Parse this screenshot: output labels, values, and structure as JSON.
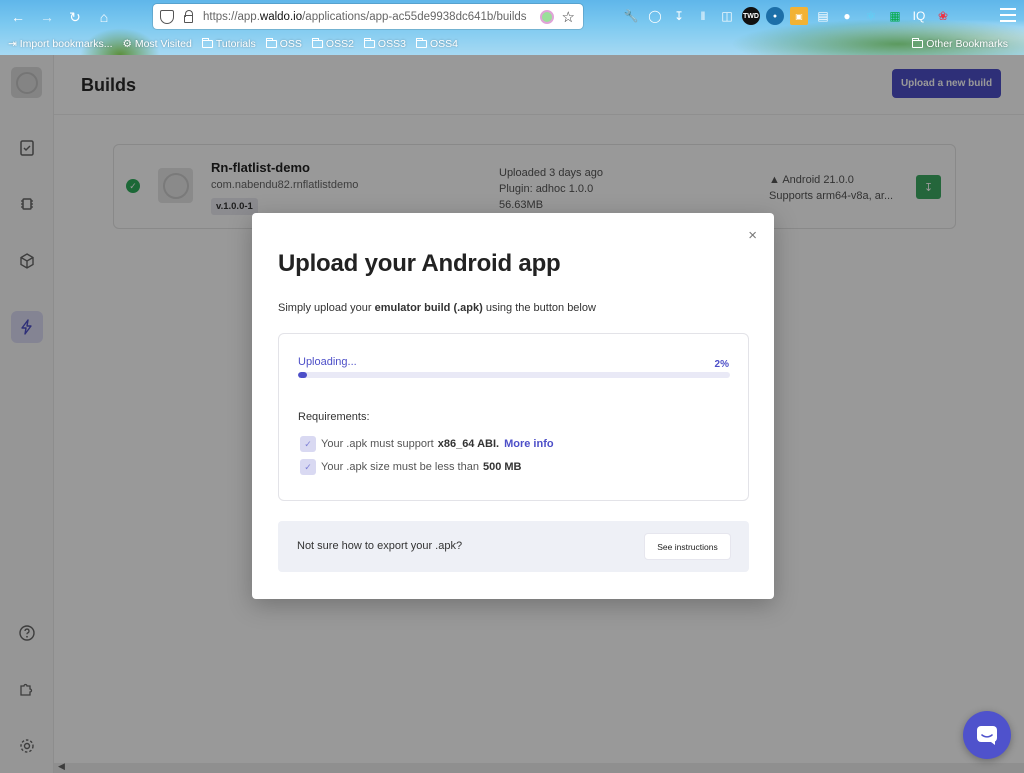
{
  "browser": {
    "url_prefix": "https://app.",
    "url_domain": "waldo.io",
    "url_path": "/applications/app-ac55de9938dc641b/builds",
    "bookmarks": [
      {
        "label": "Import bookmarks..."
      },
      {
        "label": "Most Visited"
      },
      {
        "label": "Tutorials"
      },
      {
        "label": "OSS"
      },
      {
        "label": "OSS2"
      },
      {
        "label": "OSS3"
      },
      {
        "label": "OSS4"
      }
    ],
    "other_bookmarks": "Other Bookmarks",
    "ext_badges": {
      "twd": "TWD",
      "iq": "IQ"
    }
  },
  "header": {
    "title": "Builds",
    "upload_button": "Upload a new build"
  },
  "build": {
    "name": "Rn-flatlist-demo",
    "package": "com.nabendu82.rnflatlistdemo",
    "version": "v.1.0.0-1",
    "uploaded": "Uploaded 3 days ago",
    "plugin": "Plugin: adhoc 1.0.0",
    "size": "56.63MB",
    "android": "Android 21.0.0",
    "supports": "Supports arm64-v8a, ar..."
  },
  "modal": {
    "close_glyph": "×",
    "title": "Upload your Android app",
    "subtitle_pre": "Simply upload your ",
    "subtitle_bold": "emulator build (.apk)",
    "subtitle_post": " using the button below",
    "uploading_label": "Uploading...",
    "progress_text": "2%",
    "progress_fraction": 0.02,
    "requirements_title": "Requirements:",
    "req1_text": "Your .apk must support",
    "req1_bold": "x86_64 ABI.",
    "req1_link": "More info",
    "req2_text": "Your .apk size must be less than",
    "req2_bold": "500 MB",
    "help_text": "Not sure how to export your .apk?",
    "help_button": "See instructions"
  },
  "colors": {
    "accent": "#4d4fc8",
    "success": "#2fae5c"
  }
}
